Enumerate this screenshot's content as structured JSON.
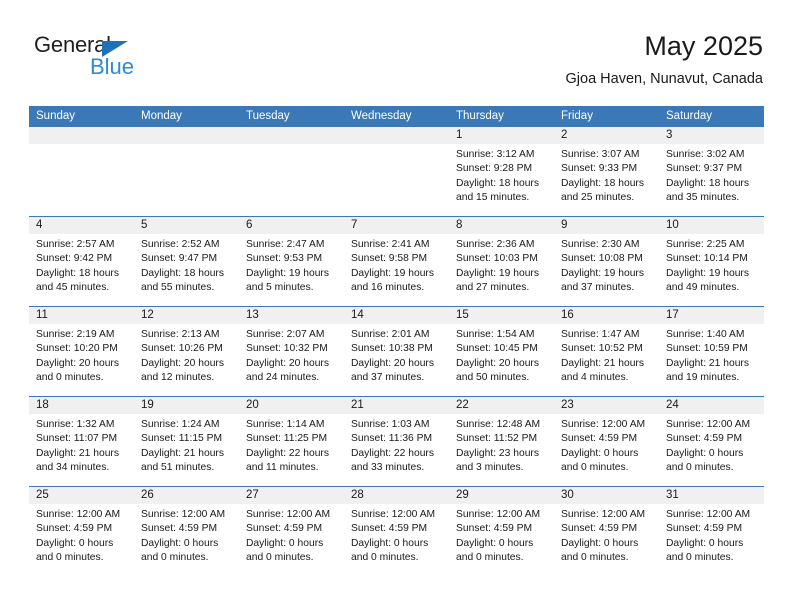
{
  "brand": {
    "name_part1": "General",
    "name_part2": "Blue",
    "triangle_icon": "triangle-icon",
    "color_dark": "#231f20",
    "color_blue": "#2d8bd4"
  },
  "header": {
    "title": "May 2025",
    "subtitle": "Gjoa Haven, Nunavut, Canada"
  },
  "theme": {
    "header_blue": "#3a78b7",
    "daynum_band": "#f0f0f0",
    "text": "#1a1a1a"
  },
  "calendar": {
    "weekdays": [
      "Sunday",
      "Monday",
      "Tuesday",
      "Wednesday",
      "Thursday",
      "Friday",
      "Saturday"
    ],
    "weeks": [
      [
        {
          "day": "",
          "lines": []
        },
        {
          "day": "",
          "lines": []
        },
        {
          "day": "",
          "lines": []
        },
        {
          "day": "",
          "lines": []
        },
        {
          "day": "1",
          "lines": [
            "Sunrise: 3:12 AM",
            "Sunset: 9:28 PM",
            "Daylight: 18 hours",
            "and 15 minutes."
          ]
        },
        {
          "day": "2",
          "lines": [
            "Sunrise: 3:07 AM",
            "Sunset: 9:33 PM",
            "Daylight: 18 hours",
            "and 25 minutes."
          ]
        },
        {
          "day": "3",
          "lines": [
            "Sunrise: 3:02 AM",
            "Sunset: 9:37 PM",
            "Daylight: 18 hours",
            "and 35 minutes."
          ]
        }
      ],
      [
        {
          "day": "4",
          "lines": [
            "Sunrise: 2:57 AM",
            "Sunset: 9:42 PM",
            "Daylight: 18 hours",
            "and 45 minutes."
          ]
        },
        {
          "day": "5",
          "lines": [
            "Sunrise: 2:52 AM",
            "Sunset: 9:47 PM",
            "Daylight: 18 hours",
            "and 55 minutes."
          ]
        },
        {
          "day": "6",
          "lines": [
            "Sunrise: 2:47 AM",
            "Sunset: 9:53 PM",
            "Daylight: 19 hours",
            "and 5 minutes."
          ]
        },
        {
          "day": "7",
          "lines": [
            "Sunrise: 2:41 AM",
            "Sunset: 9:58 PM",
            "Daylight: 19 hours",
            "and 16 minutes."
          ]
        },
        {
          "day": "8",
          "lines": [
            "Sunrise: 2:36 AM",
            "Sunset: 10:03 PM",
            "Daylight: 19 hours",
            "and 27 minutes."
          ]
        },
        {
          "day": "9",
          "lines": [
            "Sunrise: 2:30 AM",
            "Sunset: 10:08 PM",
            "Daylight: 19 hours",
            "and 37 minutes."
          ]
        },
        {
          "day": "10",
          "lines": [
            "Sunrise: 2:25 AM",
            "Sunset: 10:14 PM",
            "Daylight: 19 hours",
            "and 49 minutes."
          ]
        }
      ],
      [
        {
          "day": "11",
          "lines": [
            "Sunrise: 2:19 AM",
            "Sunset: 10:20 PM",
            "Daylight: 20 hours",
            "and 0 minutes."
          ]
        },
        {
          "day": "12",
          "lines": [
            "Sunrise: 2:13 AM",
            "Sunset: 10:26 PM",
            "Daylight: 20 hours",
            "and 12 minutes."
          ]
        },
        {
          "day": "13",
          "lines": [
            "Sunrise: 2:07 AM",
            "Sunset: 10:32 PM",
            "Daylight: 20 hours",
            "and 24 minutes."
          ]
        },
        {
          "day": "14",
          "lines": [
            "Sunrise: 2:01 AM",
            "Sunset: 10:38 PM",
            "Daylight: 20 hours",
            "and 37 minutes."
          ]
        },
        {
          "day": "15",
          "lines": [
            "Sunrise: 1:54 AM",
            "Sunset: 10:45 PM",
            "Daylight: 20 hours",
            "and 50 minutes."
          ]
        },
        {
          "day": "16",
          "lines": [
            "Sunrise: 1:47 AM",
            "Sunset: 10:52 PM",
            "Daylight: 21 hours",
            "and 4 minutes."
          ]
        },
        {
          "day": "17",
          "lines": [
            "Sunrise: 1:40 AM",
            "Sunset: 10:59 PM",
            "Daylight: 21 hours",
            "and 19 minutes."
          ]
        }
      ],
      [
        {
          "day": "18",
          "lines": [
            "Sunrise: 1:32 AM",
            "Sunset: 11:07 PM",
            "Daylight: 21 hours",
            "and 34 minutes."
          ]
        },
        {
          "day": "19",
          "lines": [
            "Sunrise: 1:24 AM",
            "Sunset: 11:15 PM",
            "Daylight: 21 hours",
            "and 51 minutes."
          ]
        },
        {
          "day": "20",
          "lines": [
            "Sunrise: 1:14 AM",
            "Sunset: 11:25 PM",
            "Daylight: 22 hours",
            "and 11 minutes."
          ]
        },
        {
          "day": "21",
          "lines": [
            "Sunrise: 1:03 AM",
            "Sunset: 11:36 PM",
            "Daylight: 22 hours",
            "and 33 minutes."
          ]
        },
        {
          "day": "22",
          "lines": [
            "Sunrise: 12:48 AM",
            "Sunset: 11:52 PM",
            "Daylight: 23 hours",
            "and 3 minutes."
          ]
        },
        {
          "day": "23",
          "lines": [
            "Sunrise: 12:00 AM",
            "Sunset: 4:59 PM",
            "Daylight: 0 hours",
            "and 0 minutes."
          ]
        },
        {
          "day": "24",
          "lines": [
            "Sunrise: 12:00 AM",
            "Sunset: 4:59 PM",
            "Daylight: 0 hours",
            "and 0 minutes."
          ]
        }
      ],
      [
        {
          "day": "25",
          "lines": [
            "Sunrise: 12:00 AM",
            "Sunset: 4:59 PM",
            "Daylight: 0 hours",
            "and 0 minutes."
          ]
        },
        {
          "day": "26",
          "lines": [
            "Sunrise: 12:00 AM",
            "Sunset: 4:59 PM",
            "Daylight: 0 hours",
            "and 0 minutes."
          ]
        },
        {
          "day": "27",
          "lines": [
            "Sunrise: 12:00 AM",
            "Sunset: 4:59 PM",
            "Daylight: 0 hours",
            "and 0 minutes."
          ]
        },
        {
          "day": "28",
          "lines": [
            "Sunrise: 12:00 AM",
            "Sunset: 4:59 PM",
            "Daylight: 0 hours",
            "and 0 minutes."
          ]
        },
        {
          "day": "29",
          "lines": [
            "Sunrise: 12:00 AM",
            "Sunset: 4:59 PM",
            "Daylight: 0 hours",
            "and 0 minutes."
          ]
        },
        {
          "day": "30",
          "lines": [
            "Sunrise: 12:00 AM",
            "Sunset: 4:59 PM",
            "Daylight: 0 hours",
            "and 0 minutes."
          ]
        },
        {
          "day": "31",
          "lines": [
            "Sunrise: 12:00 AM",
            "Sunset: 4:59 PM",
            "Daylight: 0 hours",
            "and 0 minutes."
          ]
        }
      ]
    ]
  }
}
